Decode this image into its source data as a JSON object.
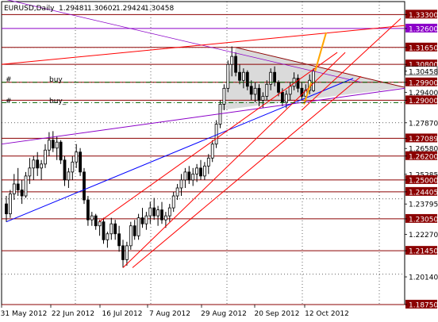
{
  "header": {
    "symbol": "EURUSD,Daily",
    "open": "1.29481",
    "high": "1.30602",
    "low": "1.29424",
    "close": "1.30458"
  },
  "colors": {
    "bg": "#ffffff",
    "grid": "#000000",
    "candle": "#000000",
    "level": "#8b0000",
    "level_label_bg": "#8b0000",
    "purple": "#8b00c8",
    "triangle_fill": "#d3d3d3",
    "channel_red": "#ff0000",
    "trend_blue": "#0000ff",
    "order_green": "#006400",
    "orange": "#ffa500",
    "current_label_bg": "#ffffff",
    "yellow_label_bg": "#ffff00"
  },
  "order_labels": [
    {
      "text": "#",
      "label": "buy"
    },
    {
      "text": "#",
      "label": "buy_"
    }
  ],
  "chart_data": {
    "type": "candlestick",
    "title": "EURUSD,Daily",
    "ylim": [
      1.1875,
      1.3395
    ],
    "x_ticks": [
      "31 May 2012",
      "22 Jun 2012",
      "16 Jul 2012",
      "7 Aug 2012",
      "29 Aug 2012",
      "20 Sep 2012",
      "12 Oct 2012"
    ],
    "y_ticks": [
      "1.33300",
      "1.32600",
      "1.31650",
      "1.30800",
      "1.30458",
      "1.29900",
      "1.29400",
      "1.29000",
      "1.27870",
      "1.27089",
      "1.26580",
      "1.26200",
      "1.25285",
      "1.25000",
      "1.24405",
      "1.23795",
      "1.23050",
      "1.22270",
      "1.21450",
      "1.20140",
      "1.18750"
    ],
    "levels": [
      1.333,
      1.3165,
      1.308,
      1.299,
      1.29,
      1.27089,
      1.262,
      1.25,
      1.24405,
      1.2305,
      1.2145,
      1.1875
    ],
    "purple_level": 1.326,
    "current_price": 1.30458,
    "order_levels": [
      1.299,
      1.29
    ],
    "candles": [
      {
        "o": 1.238,
        "h": 1.242,
        "l": 1.229,
        "c": 1.233
      },
      {
        "o": 1.233,
        "h": 1.245,
        "l": 1.231,
        "c": 1.243
      },
      {
        "o": 1.243,
        "h": 1.253,
        "l": 1.24,
        "c": 1.248
      },
      {
        "o": 1.248,
        "h": 1.256,
        "l": 1.242,
        "c": 1.245
      },
      {
        "o": 1.245,
        "h": 1.25,
        "l": 1.238,
        "c": 1.242
      },
      {
        "o": 1.242,
        "h": 1.254,
        "l": 1.241,
        "c": 1.252
      },
      {
        "o": 1.252,
        "h": 1.261,
        "l": 1.248,
        "c": 1.256
      },
      {
        "o": 1.256,
        "h": 1.262,
        "l": 1.25,
        "c": 1.26
      },
      {
        "o": 1.26,
        "h": 1.264,
        "l": 1.252,
        "c": 1.256
      },
      {
        "o": 1.256,
        "h": 1.26,
        "l": 1.25,
        "c": 1.258
      },
      {
        "o": 1.258,
        "h": 1.268,
        "l": 1.256,
        "c": 1.265
      },
      {
        "o": 1.265,
        "h": 1.274,
        "l": 1.262,
        "c": 1.27
      },
      {
        "o": 1.27,
        "h": 1.2745,
        "l": 1.264,
        "c": 1.266
      },
      {
        "o": 1.266,
        "h": 1.272,
        "l": 1.26,
        "c": 1.269
      },
      {
        "o": 1.269,
        "h": 1.27,
        "l": 1.258,
        "c": 1.26
      },
      {
        "o": 1.26,
        "h": 1.262,
        "l": 1.247,
        "c": 1.25
      },
      {
        "o": 1.25,
        "h": 1.256,
        "l": 1.246,
        "c": 1.254
      },
      {
        "o": 1.254,
        "h": 1.262,
        "l": 1.25,
        "c": 1.259
      },
      {
        "o": 1.259,
        "h": 1.268,
        "l": 1.256,
        "c": 1.264
      },
      {
        "o": 1.264,
        "h": 1.266,
        "l": 1.252,
        "c": 1.254
      },
      {
        "o": 1.254,
        "h": 1.256,
        "l": 1.238,
        "c": 1.24
      },
      {
        "o": 1.24,
        "h": 1.242,
        "l": 1.227,
        "c": 1.23
      },
      {
        "o": 1.23,
        "h": 1.234,
        "l": 1.227,
        "c": 1.232
      },
      {
        "o": 1.232,
        "h": 1.233,
        "l": 1.225,
        "c": 1.227
      },
      {
        "o": 1.227,
        "h": 1.23,
        "l": 1.222,
        "c": 1.229
      },
      {
        "o": 1.229,
        "h": 1.231,
        "l": 1.218,
        "c": 1.22
      },
      {
        "o": 1.22,
        "h": 1.224,
        "l": 1.216,
        "c": 1.223
      },
      {
        "o": 1.223,
        "h": 1.231,
        "l": 1.22,
        "c": 1.228
      },
      {
        "o": 1.228,
        "h": 1.23,
        "l": 1.22,
        "c": 1.223
      },
      {
        "o": 1.223,
        "h": 1.227,
        "l": 1.214,
        "c": 1.217
      },
      {
        "o": 1.217,
        "h": 1.22,
        "l": 1.206,
        "c": 1.21
      },
      {
        "o": 1.21,
        "h": 1.219,
        "l": 1.207,
        "c": 1.217
      },
      {
        "o": 1.217,
        "h": 1.229,
        "l": 1.215,
        "c": 1.227
      },
      {
        "o": 1.227,
        "h": 1.23,
        "l": 1.22,
        "c": 1.222
      },
      {
        "o": 1.222,
        "h": 1.233,
        "l": 1.22,
        "c": 1.231
      },
      {
        "o": 1.231,
        "h": 1.236,
        "l": 1.226,
        "c": 1.228
      },
      {
        "o": 1.228,
        "h": 1.234,
        "l": 1.225,
        "c": 1.232
      },
      {
        "o": 1.232,
        "h": 1.239,
        "l": 1.228,
        "c": 1.236
      },
      {
        "o": 1.236,
        "h": 1.241,
        "l": 1.23,
        "c": 1.232
      },
      {
        "o": 1.232,
        "h": 1.237,
        "l": 1.227,
        "c": 1.235
      },
      {
        "o": 1.235,
        "h": 1.239,
        "l": 1.228,
        "c": 1.23
      },
      {
        "o": 1.23,
        "h": 1.234,
        "l": 1.226,
        "c": 1.232
      },
      {
        "o": 1.232,
        "h": 1.238,
        "l": 1.229,
        "c": 1.236
      },
      {
        "o": 1.236,
        "h": 1.244,
        "l": 1.234,
        "c": 1.242
      },
      {
        "o": 1.242,
        "h": 1.248,
        "l": 1.24,
        "c": 1.246
      },
      {
        "o": 1.246,
        "h": 1.253,
        "l": 1.242,
        "c": 1.25
      },
      {
        "o": 1.25,
        "h": 1.256,
        "l": 1.246,
        "c": 1.254
      },
      {
        "o": 1.254,
        "h": 1.257,
        "l": 1.248,
        "c": 1.25
      },
      {
        "o": 1.25,
        "h": 1.256,
        "l": 1.247,
        "c": 1.253
      },
      {
        "o": 1.253,
        "h": 1.258,
        "l": 1.249,
        "c": 1.256
      },
      {
        "o": 1.256,
        "h": 1.26,
        "l": 1.25,
        "c": 1.252
      },
      {
        "o": 1.252,
        "h": 1.259,
        "l": 1.25,
        "c": 1.257
      },
      {
        "o": 1.257,
        "h": 1.263,
        "l": 1.253,
        "c": 1.261
      },
      {
        "o": 1.261,
        "h": 1.27,
        "l": 1.259,
        "c": 1.268
      },
      {
        "o": 1.268,
        "h": 1.28,
        "l": 1.266,
        "c": 1.278
      },
      {
        "o": 1.278,
        "h": 1.29,
        "l": 1.276,
        "c": 1.288
      },
      {
        "o": 1.288,
        "h": 1.298,
        "l": 1.285,
        "c": 1.296
      },
      {
        "o": 1.296,
        "h": 1.31,
        "l": 1.294,
        "c": 1.308
      },
      {
        "o": 1.308,
        "h": 1.317,
        "l": 1.302,
        "c": 1.312
      },
      {
        "o": 1.312,
        "h": 1.314,
        "l": 1.302,
        "c": 1.304
      },
      {
        "o": 1.304,
        "h": 1.308,
        "l": 1.298,
        "c": 1.3
      },
      {
        "o": 1.3,
        "h": 1.306,
        "l": 1.296,
        "c": 1.304
      },
      {
        "o": 1.304,
        "h": 1.305,
        "l": 1.295,
        "c": 1.297
      },
      {
        "o": 1.297,
        "h": 1.3,
        "l": 1.29,
        "c": 1.293
      },
      {
        "o": 1.293,
        "h": 1.299,
        "l": 1.289,
        "c": 1.296
      },
      {
        "o": 1.296,
        "h": 1.298,
        "l": 1.287,
        "c": 1.29
      },
      {
        "o": 1.29,
        "h": 1.294,
        "l": 1.286,
        "c": 1.292
      },
      {
        "o": 1.292,
        "h": 1.3,
        "l": 1.29,
        "c": 1.298
      },
      {
        "o": 1.298,
        "h": 1.306,
        "l": 1.295,
        "c": 1.304
      },
      {
        "o": 1.304,
        "h": 1.307,
        "l": 1.297,
        "c": 1.299
      },
      {
        "o": 1.299,
        "h": 1.3,
        "l": 1.292,
        "c": 1.294
      },
      {
        "o": 1.294,
        "h": 1.296,
        "l": 1.287,
        "c": 1.289
      },
      {
        "o": 1.289,
        "h": 1.295,
        "l": 1.286,
        "c": 1.293
      },
      {
        "o": 1.293,
        "h": 1.299,
        "l": 1.29,
        "c": 1.297
      },
      {
        "o": 1.297,
        "h": 1.304,
        "l": 1.295,
        "c": 1.301
      },
      {
        "o": 1.301,
        "h": 1.303,
        "l": 1.294,
        "c": 1.296
      },
      {
        "o": 1.296,
        "h": 1.299,
        "l": 1.29,
        "c": 1.292
      },
      {
        "o": 1.292,
        "h": 1.298,
        "l": 1.289,
        "c": 1.295
      },
      {
        "o": 1.295,
        "h": 1.303,
        "l": 1.293,
        "c": 1.3
      },
      {
        "o": 1.2948,
        "h": 1.306,
        "l": 1.2942,
        "c": 1.3046
      }
    ]
  }
}
